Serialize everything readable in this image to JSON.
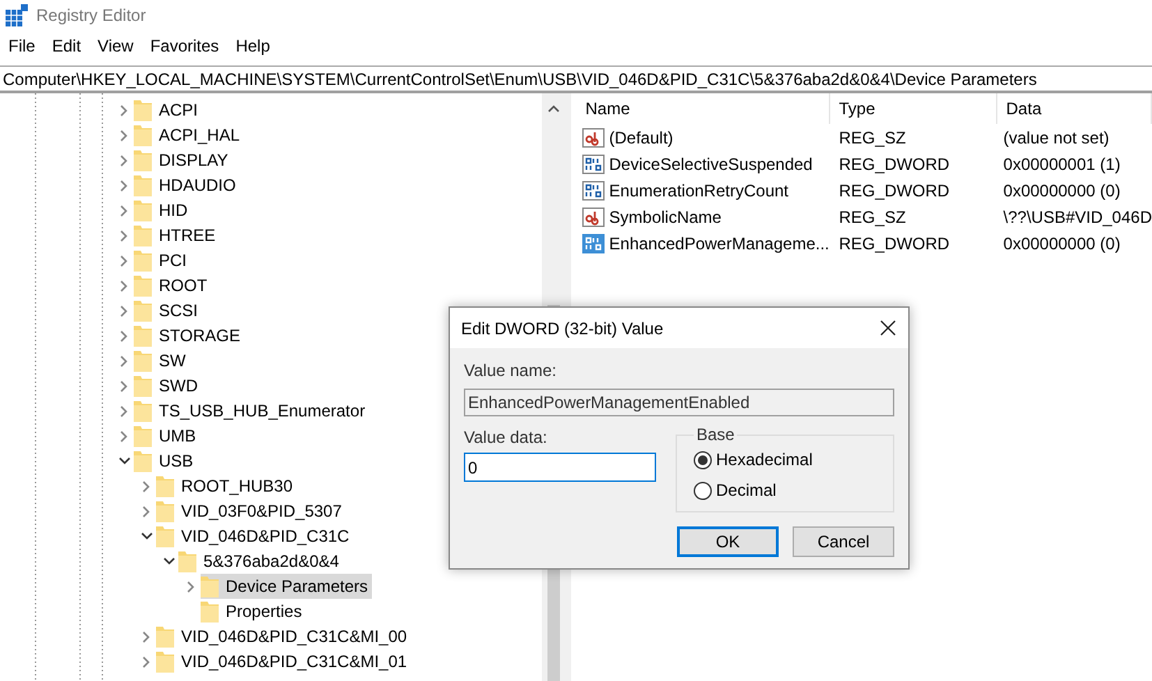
{
  "window": {
    "title": "Registry Editor"
  },
  "menu": [
    "File",
    "Edit",
    "View",
    "Favorites",
    "Help"
  ],
  "address": "Computer\\HKEY_LOCAL_MACHINE\\SYSTEM\\CurrentControlSet\\Enum\\USB\\VID_046D&PID_C31C\\5&376aba2d&0&4\\Device Parameters",
  "tree": [
    {
      "label": "ACPI",
      "expanded": false,
      "selected": false
    },
    {
      "label": "ACPI_HAL",
      "expanded": false,
      "selected": false
    },
    {
      "label": "DISPLAY",
      "expanded": false,
      "selected": false
    },
    {
      "label": "HDAUDIO",
      "expanded": false,
      "selected": false
    },
    {
      "label": "HID",
      "expanded": false,
      "selected": false
    },
    {
      "label": "HTREE",
      "expanded": false,
      "selected": false
    },
    {
      "label": "PCI",
      "expanded": false,
      "selected": false
    },
    {
      "label": "ROOT",
      "expanded": false,
      "selected": false
    },
    {
      "label": "SCSI",
      "expanded": false,
      "selected": false
    },
    {
      "label": "STORAGE",
      "expanded": false,
      "selected": false
    },
    {
      "label": "SW",
      "expanded": false,
      "selected": false
    },
    {
      "label": "SWD",
      "expanded": false,
      "selected": false
    },
    {
      "label": "TS_USB_HUB_Enumerator",
      "expanded": false,
      "selected": false
    },
    {
      "label": "UMB",
      "expanded": false,
      "selected": false
    },
    {
      "label": "USB",
      "expanded": true,
      "selected": false,
      "children": [
        {
          "label": "ROOT_HUB30",
          "expanded": false,
          "selected": false
        },
        {
          "label": "VID_03F0&PID_5307",
          "expanded": false,
          "selected": false
        },
        {
          "label": "VID_046D&PID_C31C",
          "expanded": true,
          "selected": false,
          "children": [
            {
              "label": "5&376aba2d&0&4",
              "expanded": true,
              "selected": false,
              "children": [
                {
                  "label": "Device Parameters",
                  "expanded": false,
                  "selected": true
                },
                {
                  "label": "Properties",
                  "selected": false
                }
              ]
            }
          ]
        },
        {
          "label": "VID_046D&PID_C31C&MI_00",
          "expanded": false,
          "selected": false
        },
        {
          "label": "VID_046D&PID_C31C&MI_01",
          "expanded": false,
          "selected": false
        }
      ]
    }
  ],
  "values": {
    "columns": [
      "Name",
      "Type",
      "Data"
    ],
    "rows": [
      {
        "kind": "string",
        "name": "(Default)",
        "type": "REG_SZ",
        "data": "(value not set)",
        "selected": false
      },
      {
        "kind": "binary",
        "name": "DeviceSelectiveSuspended",
        "type": "REG_DWORD",
        "data": "0x00000001 (1)",
        "selected": false
      },
      {
        "kind": "binary",
        "name": "EnumerationRetryCount",
        "type": "REG_DWORD",
        "data": "0x00000000 (0)",
        "selected": false
      },
      {
        "kind": "string",
        "name": "SymbolicName",
        "type": "REG_SZ",
        "data": "\\??\\USB#VID_046D",
        "selected": false
      },
      {
        "kind": "binary",
        "name": "EnhancedPowerManageme...",
        "type": "REG_DWORD",
        "data": "0x00000000 (0)",
        "selected": true
      }
    ]
  },
  "dialog": {
    "title": "Edit DWORD (32-bit) Value",
    "value_name_label": "Value name:",
    "value_name": "EnhancedPowerManagementEnabled",
    "value_data_label": "Value data:",
    "value_data": "0",
    "base_label": "Base",
    "base_options": [
      {
        "label": "Hexadecimal",
        "selected": true
      },
      {
        "label": "Decimal",
        "selected": false
      }
    ],
    "buttons": [
      {
        "label": "OK",
        "default": true
      },
      {
        "label": "Cancel",
        "default": false
      }
    ]
  }
}
